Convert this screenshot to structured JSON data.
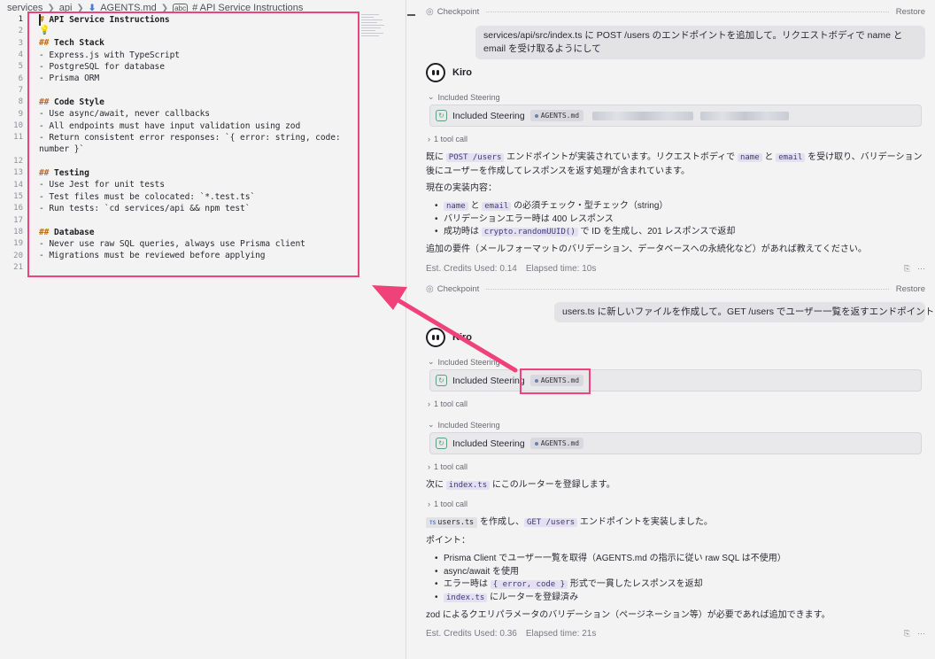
{
  "breadcrumb": {
    "p1": "services",
    "p2": "api",
    "p3": "AGENTS.md",
    "p4": "# API Service Instructions"
  },
  "editor": {
    "lines": [
      "# API Service Instructions",
      "",
      "## Tech Stack",
      "- Express.js with TypeScript",
      "- PostgreSQL for database",
      "- Prisma ORM",
      "",
      "## Code Style",
      "- Use async/await, never callbacks",
      "- All endpoints must have input validation using zod",
      "- Return consistent error responses: `{ error: string, code:",
      "number }`",
      "",
      "## Testing",
      "- Use Jest for unit tests",
      "- Test files must be colocated: `*.test.ts`",
      "- Run tests: `cd services/api && npm test`",
      "",
      "## Database",
      "- Never use raw SQL queries, always use Prisma client",
      "- Migrations must be reviewed before applying",
      ""
    ],
    "line_numbers": [
      "1",
      "2",
      "3",
      "4",
      "5",
      "6",
      "7",
      "8",
      "9",
      "10",
      "11",
      "",
      "12",
      "13",
      "14",
      "15",
      "16",
      "17",
      "18",
      "19",
      "20",
      "21"
    ]
  },
  "chat": {
    "checkpoint_label": "Checkpoint",
    "restore_label": "Restore",
    "msg1": "services/api/src/index.ts に POST /users のエンドポイントを追加して。リクエストボディで name と email を受け取るようにして",
    "kiro_name": "Kiro",
    "included_steering": "Included Steering",
    "agents_chip": "AGENTS.md",
    "tool_call": "1 tool call",
    "r1_p1a": "既に ",
    "r1_p1_code1": "POST /users",
    "r1_p1b": " エンドポイントが実装されています。リクエストボディで ",
    "r1_p1_code2": "name",
    "r1_p1c": " と ",
    "r1_p1_code3": "email",
    "r1_p1d": " を受け取り、バリデーション後にユーザーを作成してレスポンスを返す処理が含まれています。",
    "r1_p2": "現在の実装内容：",
    "r1_b1_code1": "name",
    "r1_b1a": " と ",
    "r1_b1_code2": "email",
    "r1_b1b": " の必須チェック・型チェック（string）",
    "r1_b2": "バリデーションエラー時は 400 レスポンス",
    "r1_b3a": "成功時は ",
    "r1_b3_code": "crypto.randomUUID()",
    "r1_b3b": " で ID を生成し、201 レスポンスで返却",
    "r1_p3": "追加の要件（メールフォーマットのバリデーション、データベースへの永続化など）があれば教えてください。",
    "credits1": "Est. Credits Used: 0.14",
    "elapsed1": "Elapsed time: 10s",
    "msg2": "users.ts に新しいファイルを作成して。GET /users でユーザー一覧を返すエンドポイントを実装して",
    "r2_p1a": "次に ",
    "r2_p1_code": "index.ts",
    "r2_p1b": " にこのルーターを登録します。",
    "r2_ts_icon": "TS",
    "r2_file": "users.ts",
    "r2_p2a": " を作成し、",
    "r2_p2_code": "GET /users",
    "r2_p2b": " エンドポイントを実装しました。",
    "r2_points": "ポイント：",
    "r2_b1": "Prisma Client でユーザー一覧を取得（AGENTS.md の指示に従い raw SQL は不使用）",
    "r2_b2": "async/await を使用",
    "r2_b3a": "エラー時は ",
    "r2_b3_code": "{ error, code }",
    "r2_b3b": " 形式で一貫したレスポンスを返却",
    "r2_b4_code": "index.ts",
    "r2_b4b": " にルーターを登録済み",
    "r2_p3": "zod によるクエリパラメータのバリデーション（ページネーション等）が必要であれば追加できます。",
    "credits2": "Est. Credits Used: 0.36",
    "elapsed2": "Elapsed time: 21s"
  },
  "colors": {
    "highlight": "#f0417a",
    "code_bg": "#e4e0f2",
    "heading_hash": "#c06c12"
  }
}
